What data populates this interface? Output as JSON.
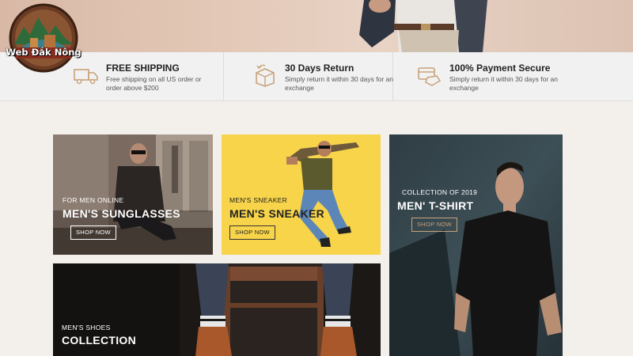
{
  "logo": {
    "text": "Web Đắk Nông"
  },
  "features": [
    {
      "icon": "delivery-truck-icon",
      "title": "FREE SHIPPING",
      "desc": "Free shipping on all US order or order above $200"
    },
    {
      "icon": "return-box-icon",
      "title": "30 Days Return",
      "desc": "Simply return it within 30 days for an exchange"
    },
    {
      "icon": "secure-payment-icon",
      "title": "100% Payment Secure",
      "desc": "Simply return it within 30 days for an exchange"
    }
  ],
  "banners": {
    "sunglasses": {
      "subtitle": "FOR MEN ONLINE",
      "title": "MEN'S SUNGLASSES",
      "button": "SHOP NOW"
    },
    "sneaker": {
      "subtitle": "MEN'S SNEAKER",
      "title": "MEN'S SNEAKER",
      "button": "SHOP NOW",
      "bg": "#f7d44a"
    },
    "tshirt": {
      "subtitle": "COLLECTION OF 2019",
      "title": "MEN' T-SHIRT",
      "button": "SHOP NOW"
    },
    "shoes": {
      "subtitle": "MEN'S SHOES",
      "title": "COLLECTION"
    }
  },
  "colors": {
    "accent": "#c8a37a",
    "feature_bg": "#f1f1f1",
    "page_bg": "#f3f0ec"
  }
}
